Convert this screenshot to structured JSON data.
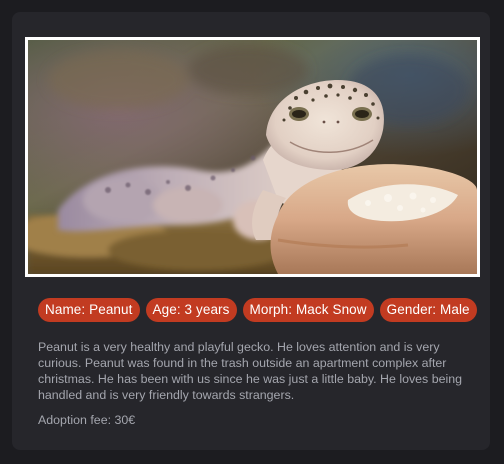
{
  "pet": {
    "photo_name": "leopard-gecko-photo",
    "tags": [
      "Name: Peanut",
      "Age: 3 years",
      "Morph: Mack Snow",
      "Gender: Male"
    ],
    "description": "Peanut is a very healthy and playful gecko. He loves attention and is very curious. Peanut was found in the trash outside an apartment complex after christmas. He has been with us since he was just a little baby. He loves being handled and is very friendly towards strangers.",
    "adoption_fee": "Adoption fee: 30€"
  },
  "colors": {
    "page_background": "#1c1c20",
    "card_background": "#26262b",
    "tag_background": "#c23b21",
    "tag_text": "#ffffff",
    "body_text": "#a4a6ae"
  }
}
